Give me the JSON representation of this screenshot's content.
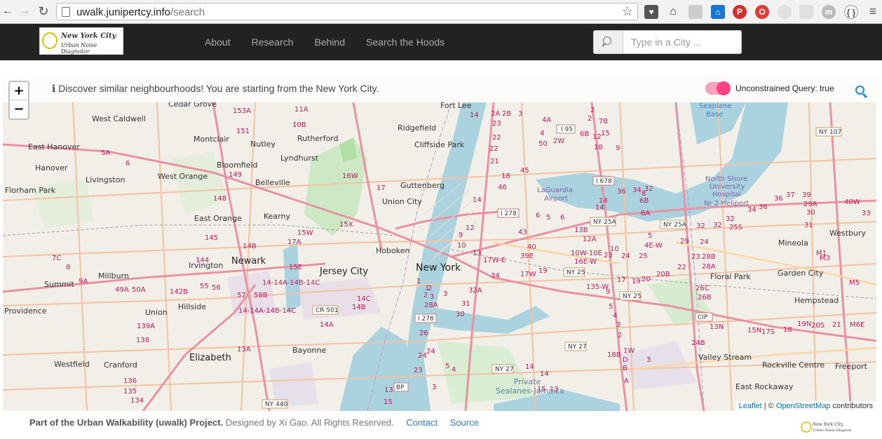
{
  "browser": {
    "url_host": "uwalk.junipertcy.info",
    "url_path": "/search"
  },
  "nav": {
    "logo_line1": "New York City",
    "logo_line2": "Urban Noise Diagnotor",
    "menu": [
      "About",
      "Research",
      "Behind",
      "Search the Hoods"
    ],
    "search_placeholder": "Type in a City ..."
  },
  "map": {
    "info_text": "Discover similar neighbourhoods! You are starting from the New York City.",
    "toggle_label": "Unconstrained Query: true",
    "toggle_on": true,
    "zoom_in": "+",
    "zoom_out": "−",
    "attribution": {
      "leaflet": "Leaflet",
      "sep": " | © ",
      "osm": "OpenStreetMap",
      "suffix": " contributors"
    },
    "places": {
      "new_york": "New York",
      "newark": "Newark",
      "jersey_city": "Jersey City",
      "hoboken": "Hoboken",
      "elizabeth": "Elizabeth",
      "union_city": "Union City",
      "guttenberg": "Guttenberg",
      "fort_lee": "Fort Lee",
      "ridgefield": "Ridgefield",
      "cliffside_park": "Cliffside Park",
      "rutherford": "Rutherford",
      "lyndhurst": "Lyndhurst",
      "nutley": "Nutley",
      "montclair": "Montclair",
      "bloomfield": "Bloomfield",
      "belleville": "Belleville",
      "kearny": "Kearny",
      "east_orange": "East Orange",
      "west_orange": "West Orange",
      "irvington": "Irvington",
      "hillside": "Hillside",
      "union": "Union",
      "millburn": "Millburn",
      "summit": "Summit",
      "bayonne": "Bayonne",
      "westfield": "Westfield",
      "cranford": "Cranford",
      "livingston": "Livingston",
      "florham_park": "Florham Park",
      "hanover": "Hanover",
      "east_hanover": "East Hanover",
      "west_caldwell": "West Caldwell",
      "cedar_grove": "Cedar Grove",
      "providence": "Providence",
      "laguardia": "LaGuardia Airport",
      "floral_park": "Floral Park",
      "garden_city": "Garden City",
      "mineola": "Mineola",
      "westbury": "Westbury",
      "hempstead": "Hempstead",
      "valley_stream": "Valley Stream",
      "rockville_centre": "Rockville Centre",
      "freeport": "Freeport",
      "east_rockaway": "East Rockaway",
      "seaplane_base": "Seaplane Base",
      "north_shore": "North Shore University Hospital Nr 2 Heliport",
      "private": "Private",
      "sealanes": "Sealanes-Jamaica"
    },
    "shields": [
      "I 95",
      "I 278",
      "I 678",
      "NY 25A",
      "NY 25",
      "CR 501",
      "I 278",
      "NY 27",
      "NY 27",
      "NY 440",
      "BP",
      "CIP",
      "NY 107",
      "NY 25A",
      "NY 25"
    ]
  },
  "footer": {
    "project": "Part of the Urban Walkability (uwalk) Project.",
    "rest": " Designed by Xi Gao. All Rights Reserved.",
    "contact": "Contact",
    "source": "Source"
  },
  "colors": {
    "navbar": "#222222",
    "toggle": "#ff4081",
    "search_icon": "#1e88e5",
    "link": "#337ab7"
  }
}
